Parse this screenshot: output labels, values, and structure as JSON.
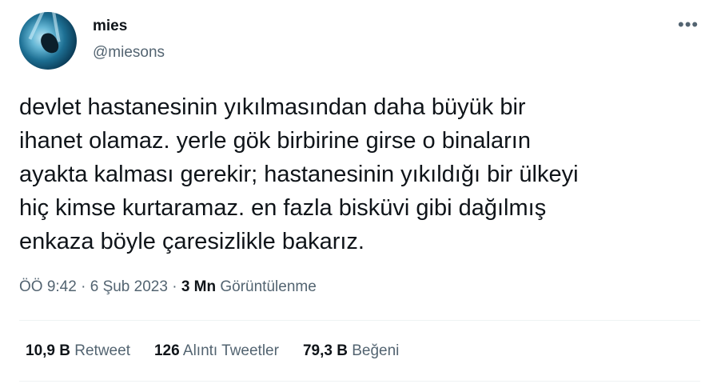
{
  "author": {
    "name": "mies",
    "handle": "@miesons"
  },
  "tweet": {
    "text": "devlet hastanesinin yıkılmasından daha büyük bir\nihanet olamaz. yerle gök birbirine girse o binaların\nayakta kalması gerekir; hastanesinin yıkıldığı bir ülkeyi\nhiç kimse kurtaramaz. en fazla bisküvi gibi dağılmış\nenkaza böyle çaresizlikle bakarız."
  },
  "meta": {
    "time": "ÖÖ 9:42",
    "sep1": "·",
    "date": "6 Şub 2023",
    "sep2": "·",
    "views_count": "3 Mn",
    "views_label": "Görüntülenme"
  },
  "stats": [
    {
      "count": "10,9 B",
      "label": "Retweet"
    },
    {
      "count": "126",
      "label": "Alıntı Tweetler"
    },
    {
      "count": "79,3 B",
      "label": "Beğeni"
    }
  ],
  "more_icon": "•••",
  "colors": {
    "text": "#0f1419",
    "secondary": "#536471",
    "divider": "#eff3f4"
  }
}
